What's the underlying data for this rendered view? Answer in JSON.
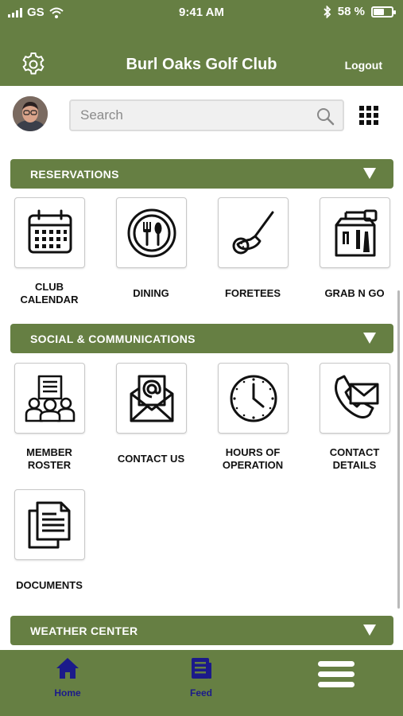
{
  "status": {
    "carrier": "GS",
    "time": "9:41 AM",
    "battery": "58 %",
    "battery_level": 0.58,
    "icons": [
      "signal-icon",
      "wifi-icon",
      "bluetooth-icon",
      "battery-icon"
    ]
  },
  "header": {
    "title": "Burl Oaks Golf Club",
    "logout_label": "Logout",
    "color": "#667f43"
  },
  "search": {
    "placeholder": "Search"
  },
  "sections": {
    "reservations": {
      "label": "RESERVATIONS",
      "items": [
        {
          "label": "CLUB CALENDAR",
          "icon": "calendar-icon"
        },
        {
          "label": "DINING",
          "icon": "dining-icon"
        },
        {
          "label": "FORETEES",
          "icon": "golf-club-icon"
        },
        {
          "label": "GRAB N GO",
          "icon": "takeout-bag-icon"
        }
      ]
    },
    "social": {
      "label": "SOCIAL & COMMUNICATIONS",
      "items": [
        {
          "label": "MEMBER ROSTER",
          "icon": "member-roster-icon"
        },
        {
          "label": "CONTACT US",
          "icon": "email-envelope-icon"
        },
        {
          "label": "HOURS OF OPERATION",
          "icon": "clock-icon"
        },
        {
          "label": "CONTACT DETAILS",
          "icon": "phone-mail-icon"
        },
        {
          "label": "DOCUMENTS",
          "icon": "documents-icon"
        }
      ]
    },
    "weather": {
      "label": "WEATHER CENTER"
    }
  },
  "tabbar": {
    "home_label": "Home",
    "feed_label": "Feed",
    "label_color": "#1b1a8a"
  }
}
